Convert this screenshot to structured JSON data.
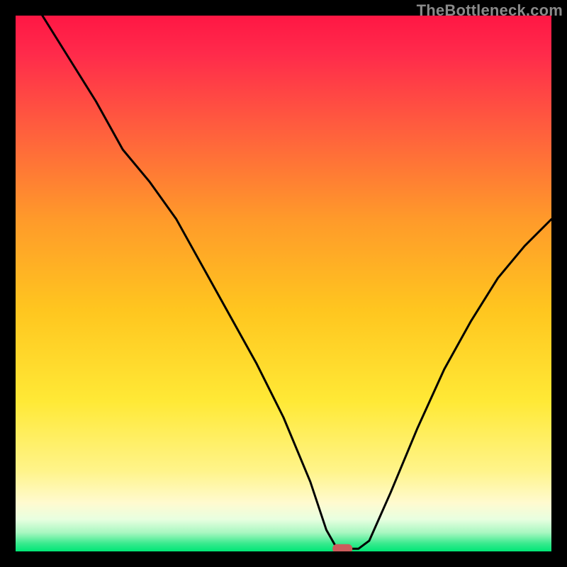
{
  "watermark": "TheBottleneck.com",
  "chart_data": {
    "type": "line",
    "title": "",
    "xlabel": "",
    "ylabel": "",
    "xlim": [
      0,
      100
    ],
    "ylim": [
      0,
      100
    ],
    "series": [
      {
        "name": "curve",
        "x": [
          5,
          10,
          15,
          20,
          25,
          30,
          35,
          40,
          45,
          50,
          55,
          58,
          60,
          62,
          64,
          66,
          70,
          75,
          80,
          85,
          90,
          95,
          100
        ],
        "y": [
          100,
          92,
          84,
          75,
          69,
          62,
          53,
          44,
          35,
          25,
          13,
          4,
          0.5,
          0.5,
          0.5,
          2,
          11,
          23,
          34,
          43,
          51,
          57,
          62
        ]
      }
    ],
    "marker": {
      "x": 61,
      "y": 0.5
    },
    "colors": {
      "marker": "#cc5c5c",
      "curve": "#000000",
      "gradient_red": "#ff1744",
      "gradient_orange": "#ffb300",
      "gradient_yellow": "#ffee58",
      "gradient_paleyellow": "#fffde7",
      "gradient_green": "#00e676"
    }
  }
}
